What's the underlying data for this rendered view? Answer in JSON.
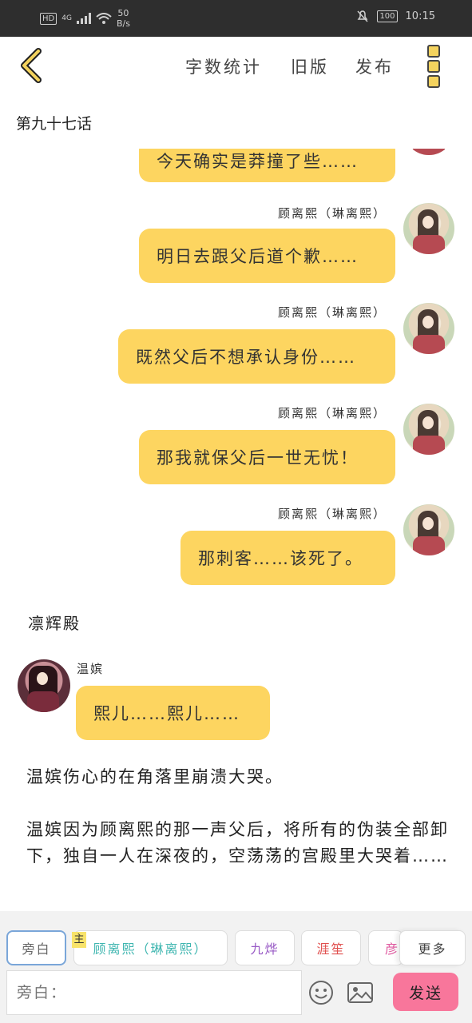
{
  "status_bar": {
    "hd": "HD",
    "network": "4G",
    "speed_value": "50",
    "speed_unit": "B/s",
    "battery": "100",
    "time": "10:15"
  },
  "header": {
    "word_count": "字数统计",
    "old_version": "旧版",
    "publish": "发布"
  },
  "chapter_title": "第九十七话",
  "messages": [
    {
      "name": "",
      "text": "今天确实是莽撞了些……"
    },
    {
      "name": "顾离熙（琳离熙）",
      "text": "明日去跟父后道个歉……"
    },
    {
      "name": "顾离熙（琳离熙）",
      "text": "既然父后不想承认身份……"
    },
    {
      "name": "顾离熙（琳离熙）",
      "text": "那我就保父后一世无忧！"
    },
    {
      "name": "顾离熙（琳离熙）",
      "text": "那刺客……该死了。"
    }
  ],
  "scene": "凛辉殿",
  "left_message": {
    "name": "温嫔",
    "text": "熙儿……熙儿……"
  },
  "narration": [
    "温嫔伤心的在角落里崩溃大哭。",
    "温嫔因为顾离熙的那一声父后，将所有的伪装全部卸下，独自一人在深夜的，空荡荡的宫殿里大哭着……"
  ],
  "characters": {
    "narrator": "旁白",
    "main_tag": "主",
    "c1": "顾离熙（琳离熙）",
    "c2": "九烨",
    "c3": "涯笙",
    "c4": "彦",
    "more": "更多"
  },
  "colors": {
    "c1": "#3fb6b0",
    "c2": "#9a5cc6",
    "c3": "#e0504f",
    "c4": "#e05aa0",
    "bubble": "#fdd560",
    "send": "#f8769b"
  },
  "composer": {
    "placeholder": "旁白：",
    "send": "发送"
  }
}
